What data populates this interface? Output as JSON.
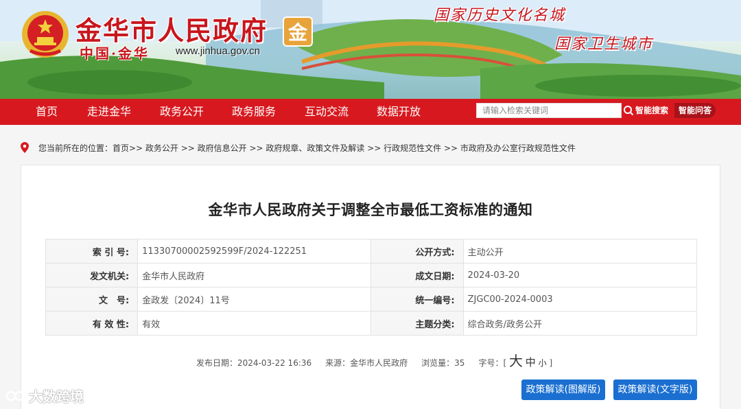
{
  "header": {
    "site_name": "金华市人民政府",
    "jin_char": "金",
    "site_sub": "中国·金华",
    "url": "www.jinhua.gov.cn",
    "slogan_1": "国家历史文化名城",
    "slogan_2": "国家卫生城市"
  },
  "nav": {
    "items": [
      "首页",
      "走进金华",
      "政务公开",
      "政务服务",
      "互动交流",
      "数据开放"
    ],
    "search_placeholder": "请输入检索关键词",
    "smart_search": "智能搜索",
    "smart_qa": "智能问答"
  },
  "breadcrumb": {
    "text": "您当前所在的位置：首页>> 政务公开 >> 政府信息公开 >> 政府规章、政策文件及解读 >> 行政规范性文件 >> 市政府及办公室行政规范性文件"
  },
  "document": {
    "title": "金华市人民政府关于调整全市最低工资标准的通知",
    "meta": [
      [
        "索 引 号:",
        "11330700002592599F/2024-122251",
        "公开方式:",
        "主动公开"
      ],
      [
        "发文机关:",
        "金华市人民政府",
        "成文日期:",
        "2024-03-20"
      ],
      [
        "文　号:",
        "金政发〔2024〕11号",
        "统一编号:",
        "ZJGC00-2024-0003"
      ],
      [
        "有 效 性:",
        "有效",
        "主题分类:",
        "综合政务/政务公开"
      ]
    ],
    "publish_date": "发布日期：2024-03-22 16:36",
    "source": "来源：金华市人民政府",
    "views": "浏览量：35",
    "font_label": "字号：[",
    "font_big": "大",
    "font_mid": "中",
    "font_small": "小",
    "font_close": "]"
  },
  "buttons": {
    "graphic": "政策解读(图解版)",
    "text": "政策解读(文字版)"
  },
  "watermark": "大数跨境",
  "colors": {
    "nav_red": "#d7191f",
    "brand_red": "#c8161d",
    "button_blue": "#1a6fd1"
  }
}
